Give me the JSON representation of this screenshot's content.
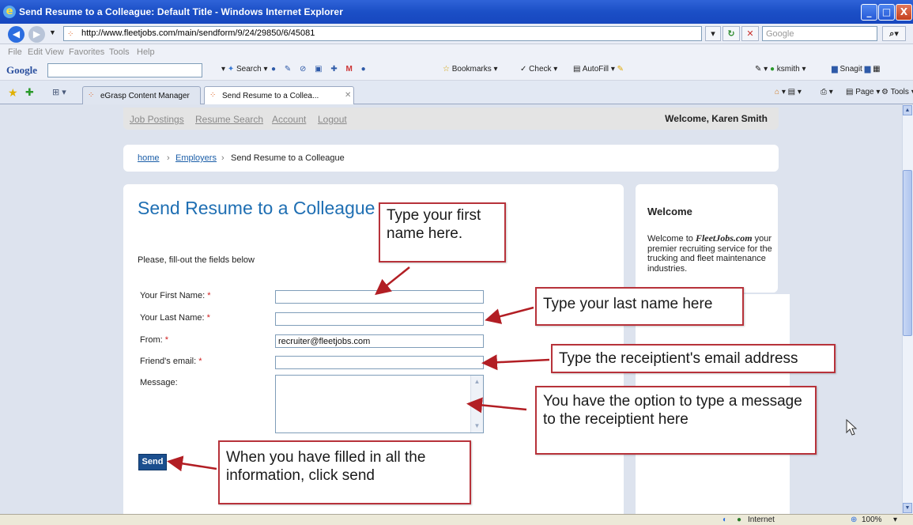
{
  "window": {
    "title": "Send Resume to a Colleague: Default Title - Windows Internet Explorer",
    "minimize": "_",
    "maximize": "□",
    "close": "X"
  },
  "address_bar": {
    "url": "http://www.fleetjobs.com/main/sendform/9/24/29850/6/45081",
    "search_placeholder": "Google"
  },
  "menu": [
    "File",
    "Edit",
    "View",
    "Favorites",
    "Tools",
    "Help"
  ],
  "google_toolbar": {
    "logo": "Google",
    "items": [
      "Search",
      "Bookmarks",
      "Check",
      "AutoFill",
      "ksmith",
      "Snagit"
    ]
  },
  "tabs": [
    {
      "label": "eGrasp Content Manager",
      "active": false
    },
    {
      "label": "Send Resume to a Collea...",
      "active": true
    }
  ],
  "command_bar": [
    "Page",
    "Tools"
  ],
  "site_nav": {
    "links": [
      "Job Postings",
      "Resume Search",
      "Account",
      "Logout"
    ],
    "welcome": "Welcome, Karen Smith"
  },
  "breadcrumb": {
    "home": "home",
    "employers": "Employers",
    "current": "Send Resume to a Colleague",
    "separator": "›"
  },
  "form": {
    "title": "Send Resume to a Colleague",
    "instructions": "Please, fill-out the fields below",
    "required_mark": "*",
    "fields": {
      "first_name": {
        "label": "Your First Name:",
        "value": ""
      },
      "last_name": {
        "label": "Your Last Name:",
        "value": ""
      },
      "from": {
        "label": "From:",
        "value": "recruiter@fleetjobs.com"
      },
      "friend_email": {
        "label": "Friend's email:",
        "value": ""
      },
      "message": {
        "label": "Message:",
        "value": ""
      }
    },
    "send_label": "Send"
  },
  "sidebar": {
    "heading": "Welcome",
    "text_before": "Welcome to ",
    "brand": "FleetJobs.com",
    "text_after": " your premier recruiting service for the trucking and fleet maintenance industries."
  },
  "callouts": {
    "first_name": "Type your first name here.",
    "last_name": "Type your last name here",
    "email": "Type the receiptient's email address",
    "message": "You have the option to type a message to the receiptient here",
    "send": "When you have filled in all the information, click send"
  },
  "status_bar": {
    "zone": "Internet",
    "zoom": "100%"
  },
  "colors": {
    "accent": "#1f6fb3",
    "callout_border": "#b7323a",
    "arrow": "#b21e24",
    "send_button": "#1b4f8e"
  }
}
